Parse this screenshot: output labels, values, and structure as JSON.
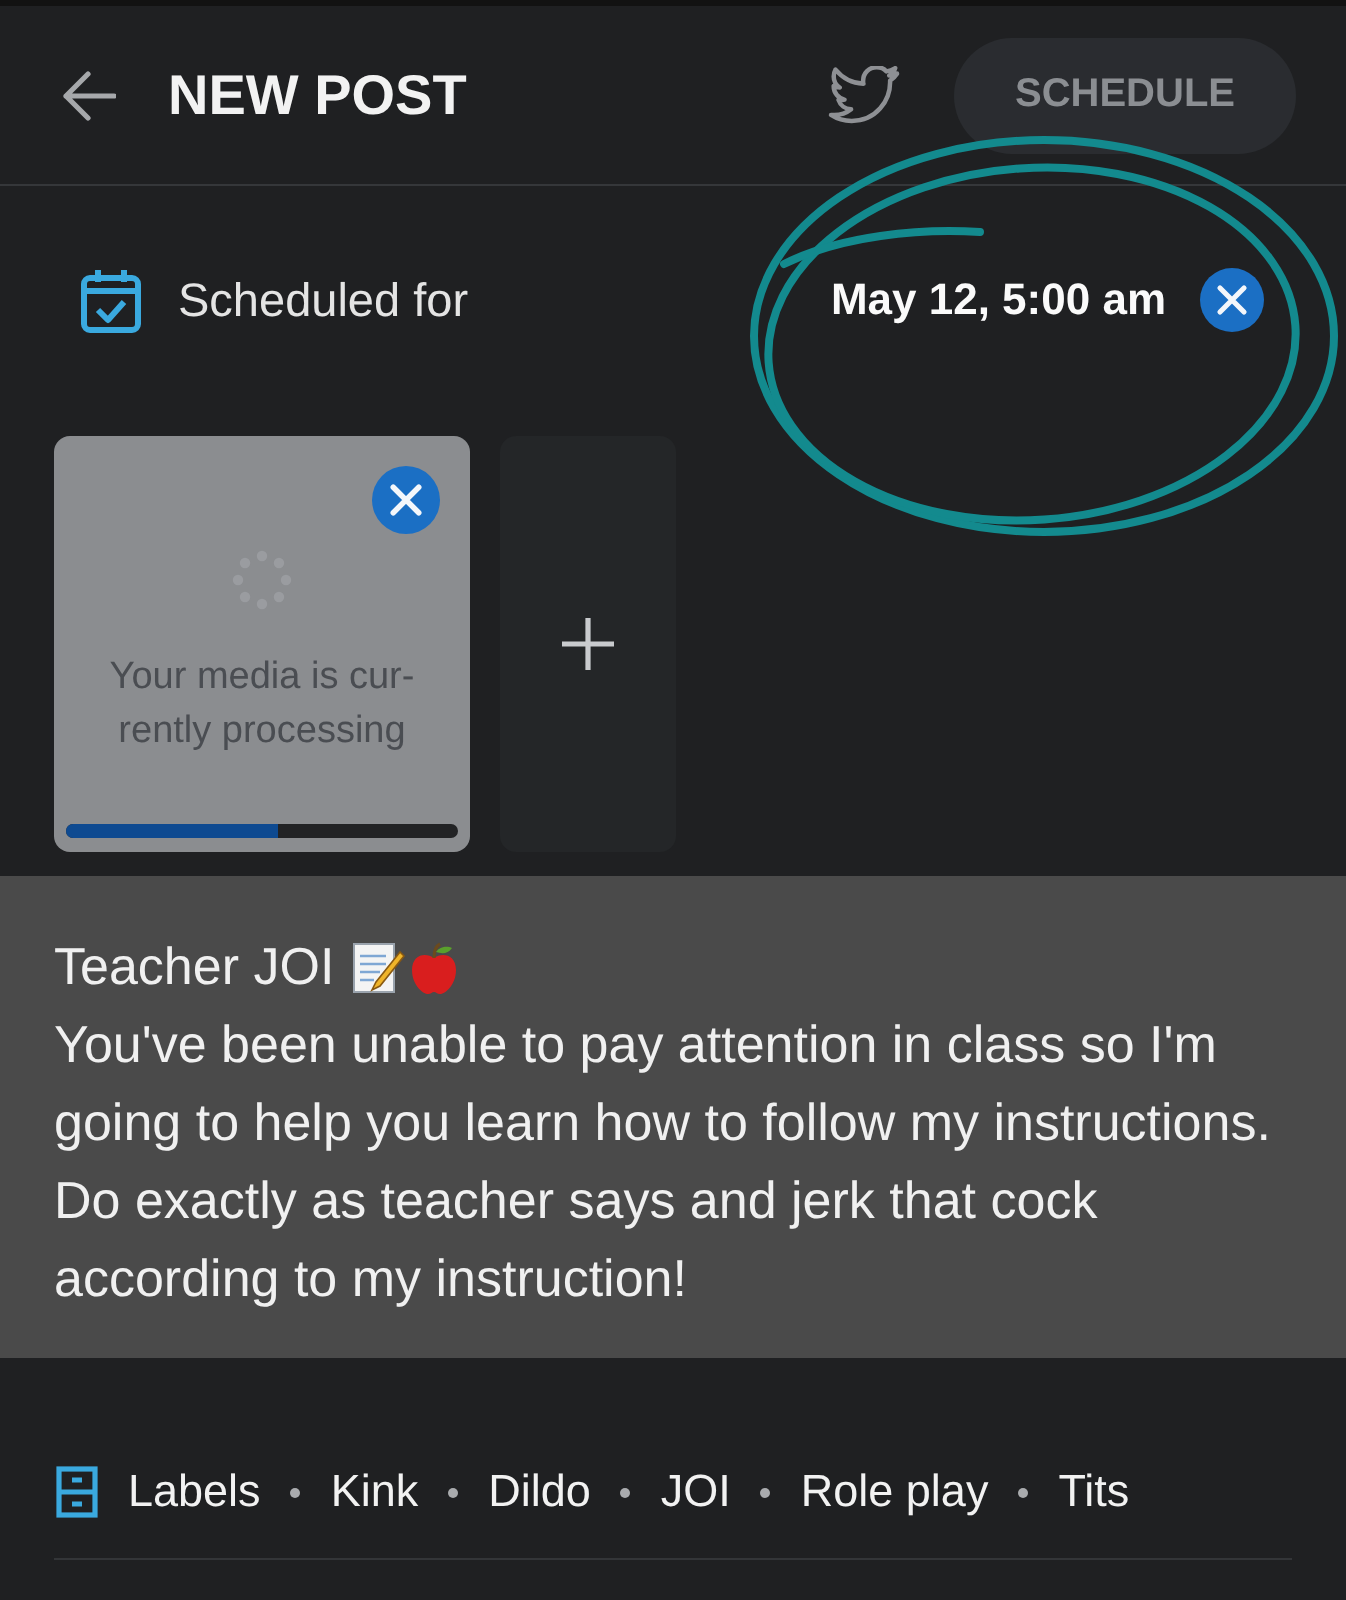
{
  "header": {
    "title": "NEW POST",
    "schedule_button": "SCHEDULE"
  },
  "schedule": {
    "label": "Scheduled for",
    "date": "May 12, 5:00 am"
  },
  "media": [
    {
      "kind": "processing",
      "message": "Your media is cur-\nrently processing",
      "level": 0.54
    },
    {
      "kind": "add"
    }
  ],
  "post": {
    "title": "Teacher JOI",
    "body": "You've been unable to pay attention in class so I'm going to help you learn how to follow my instructions. Do exactly as teacher says and jerk that cock according to my instruction!"
  },
  "labels": {
    "heading": "Labels",
    "items": [
      "Kink",
      "Dildo",
      "JOI",
      "Role play",
      "Tits"
    ]
  }
}
